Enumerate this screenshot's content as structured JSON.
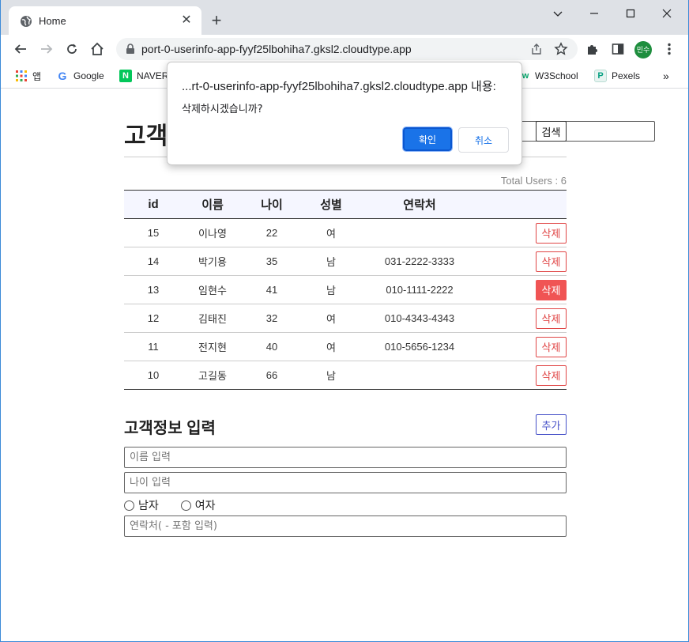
{
  "browser": {
    "tab_title": "Home",
    "url": "port-0-userinfo-app-fyyf25lbohiha7.gksl2.cloudtype.app",
    "profile_initials": "민수"
  },
  "bookmarks": [
    {
      "label": "앱",
      "icon": "apps-grid-icon"
    },
    {
      "label": "Google",
      "icon": "google-icon"
    },
    {
      "label": "NAVER",
      "icon": "naver-icon"
    },
    {
      "label": "W3School",
      "icon": "w3schools-icon"
    },
    {
      "label": "Pexels",
      "icon": "pexels-icon"
    }
  ],
  "page": {
    "heading": "고객정보",
    "search_button": "검색",
    "total_users": "Total Users : 6",
    "columns": [
      "id",
      "이름",
      "나이",
      "성별",
      "연락처",
      ""
    ],
    "delete_label": "삭제",
    "rows": [
      {
        "id": "15",
        "name": "이나영",
        "age": "22",
        "gender": "여",
        "phone": ""
      },
      {
        "id": "14",
        "name": "박기용",
        "age": "35",
        "gender": "남",
        "phone": "031-2222-3333"
      },
      {
        "id": "13",
        "name": "임현수",
        "age": "41",
        "gender": "남",
        "phone": "010-1111-2222"
      },
      {
        "id": "12",
        "name": "김태진",
        "age": "32",
        "gender": "여",
        "phone": "010-4343-4343"
      },
      {
        "id": "11",
        "name": "전지현",
        "age": "40",
        "gender": "여",
        "phone": "010-5656-1234"
      },
      {
        "id": "10",
        "name": "고길동",
        "age": "66",
        "gender": "남",
        "phone": ""
      }
    ],
    "hovered_row_id": "13"
  },
  "form": {
    "title": "고객정보 입력",
    "add_button": "추가",
    "name_placeholder": "이름 입력",
    "age_placeholder": "나이 입력",
    "gender_male": "남자",
    "gender_female": "여자",
    "phone_placeholder": "연락처( - 포함 입력)"
  },
  "dialog": {
    "title": "...rt-0-userinfo-app-fyyf25lbohiha7.gksl2.cloudtype.app 내용:",
    "message": "삭제하시겠습니까?",
    "ok_label": "확인",
    "cancel_label": "취소"
  },
  "colors": {
    "accent": "#1a73e8",
    "delete": "#e04646",
    "add": "#4651c8"
  }
}
